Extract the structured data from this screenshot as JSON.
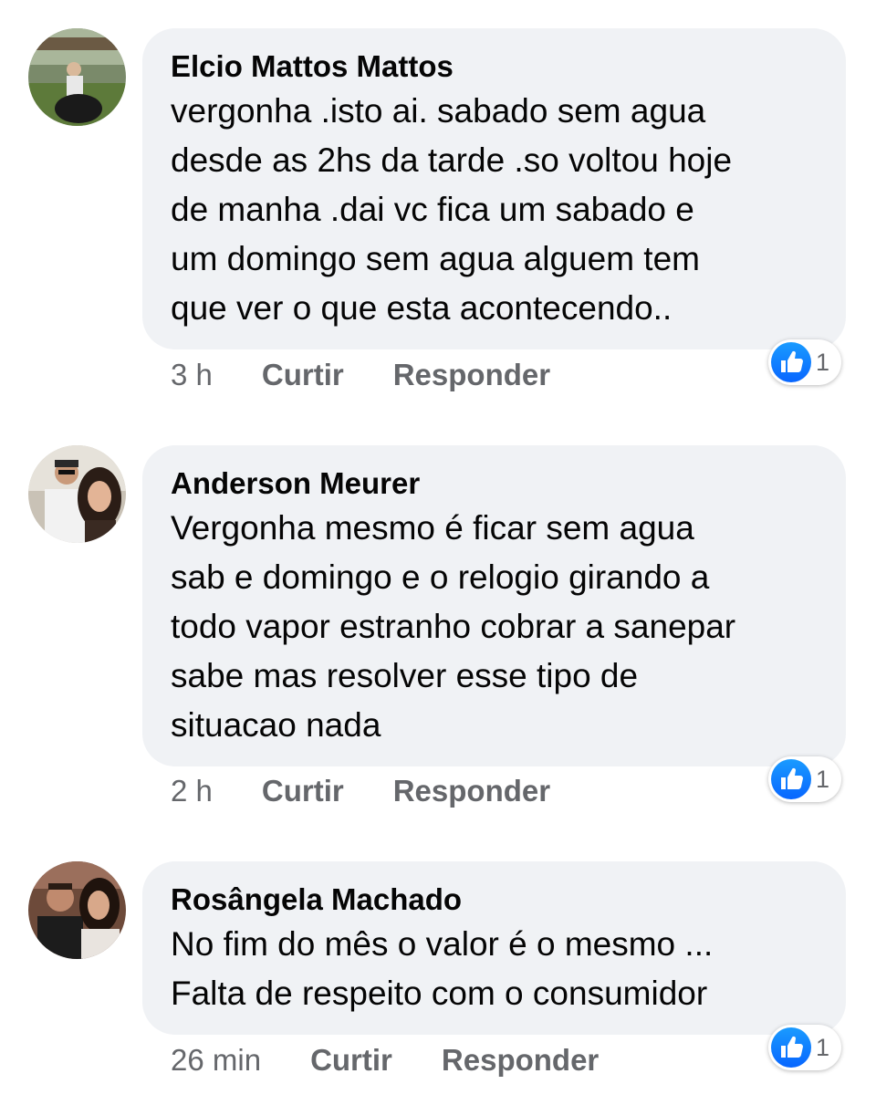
{
  "comments": [
    {
      "author": "Elcio Mattos Mattos",
      "lines": [
        "vergonha .isto ai. sabado sem agua",
        "desde as 2hs da tarde .so voltou hoje",
        "de manha .dai vc fica um sabado e",
        "um domingo sem agua alguem tem",
        "que ver o que esta acontecendo.."
      ],
      "time": "3 h",
      "like_label": "Curtir",
      "reply_label": "Responder",
      "reaction_count": "1",
      "reaction_icon": "thumbs-up-icon"
    },
    {
      "author": "Anderson Meurer",
      "lines": [
        "Vergonha mesmo é ficar sem agua",
        "sab e domingo e o relogio girando a",
        "todo vapor estranho cobrar a sanepar",
        "sabe mas resolver esse tipo de",
        "situacao nada"
      ],
      "time": "2 h",
      "like_label": "Curtir",
      "reply_label": "Responder",
      "reaction_count": "1",
      "reaction_icon": "thumbs-up-icon"
    },
    {
      "author": "Rosângela Machado",
      "lines": [
        "No fim do mês o valor é o mesmo ...",
        "Falta de respeito com o consumidor"
      ],
      "time": "26 min",
      "like_label": "Curtir",
      "reply_label": "Responder",
      "reaction_count": "1",
      "reaction_icon": "thumbs-up-icon"
    }
  ],
  "colors": {
    "bubble_bg": "#f0f2f5",
    "text": "#050505",
    "secondary_text": "#65676b",
    "like_blue": "#0866ff"
  }
}
